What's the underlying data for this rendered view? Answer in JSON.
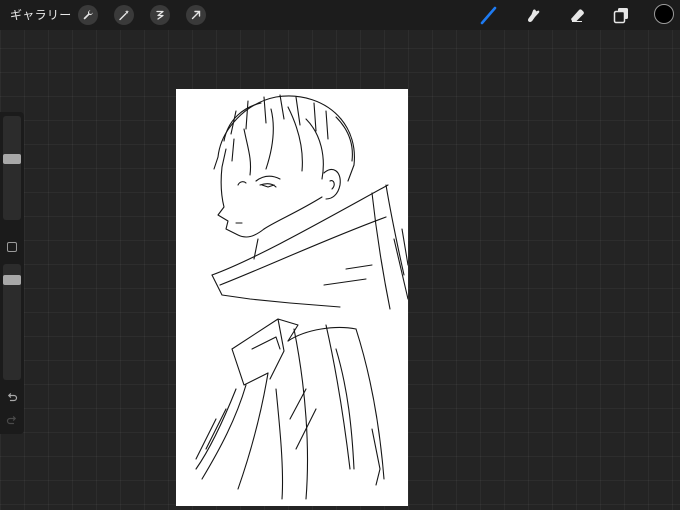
{
  "topbar": {
    "gallery_label": "ギャラリー",
    "left_tools": [
      "wrench-icon",
      "magic-wand-icon",
      "selection-icon",
      "transform-arrow-icon"
    ],
    "right_tools": [
      "brush-icon",
      "smudge-icon",
      "eraser-icon",
      "layers-icon"
    ],
    "active_tool": "brush-icon",
    "active_color": "#1e7bf2",
    "current_color": "#000000"
  },
  "sidebar": {
    "brush_size_level": 0.6,
    "opacity_level": 0.9,
    "controls": [
      "modify-button",
      "undo-arrow-icon",
      "redo-arrow-icon"
    ]
  },
  "canvas": {
    "background": "#ffffff",
    "content": "sketch-artwork"
  }
}
